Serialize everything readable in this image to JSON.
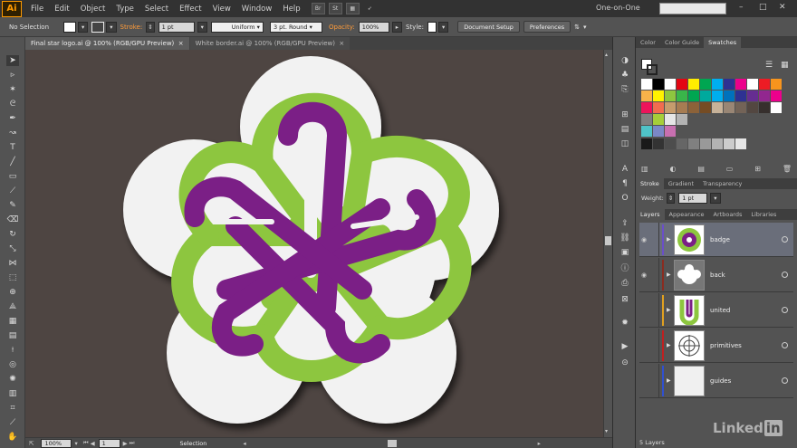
{
  "menubar": {
    "logo": "Ai",
    "items": [
      "File",
      "Edit",
      "Object",
      "Type",
      "Select",
      "Effect",
      "View",
      "Window",
      "Help"
    ],
    "app_buttons": [
      "Br",
      "St"
    ],
    "workspace": "One-on-One"
  },
  "controlbar": {
    "selection": "No Selection",
    "stroke_label": "Stroke:",
    "stroke_value": "1 pt",
    "profile": "Uniform",
    "brush": "3 pt. Round",
    "opacity_label": "Opacity:",
    "opacity_value": "100%",
    "style_label": "Style:",
    "document_setup": "Document Setup",
    "preferences": "Preferences"
  },
  "doc_tabs": [
    {
      "label": "Final star logo.ai @ 100% (RGB/GPU Preview)",
      "close": "×"
    },
    {
      "label": "White border.ai @ 100% (RGB/GPU Preview)",
      "close": "×"
    }
  ],
  "statusbar": {
    "zoom": "100%",
    "artboard": "1",
    "tool": "Selection"
  },
  "swatches_panel": {
    "tabs": [
      "Color",
      "Color Guide",
      "Swatches"
    ],
    "rows": [
      [
        "#ffffff",
        "#000000",
        "#ffffff",
        "#e30613",
        "#ffed00",
        "#00a651",
        "#00aeef",
        "#2e3192",
        "#ec008c",
        "#ffffff"
      ],
      [
        "#ed1c24",
        "#f7941d",
        "#f7b34a",
        "#fff200",
        "#8dc63f",
        "#39b54a",
        "#00a651",
        "#00a99d",
        "#00aeef",
        "#0072bc"
      ],
      [
        "#2e3192",
        "#662d91",
        "#92278f",
        "#ec008c",
        "#ed145b",
        "#f26c4f",
        "#c69c6d",
        "#a67c52",
        "#8c6239",
        "#754c24"
      ],
      [
        "#c7b299",
        "#998675",
        "#736357",
        "#534741",
        "#362f2d",
        "#ffffff",
        "#808080",
        "#a6ce39",
        "#e6e6e6",
        "#b3b3b3"
      ]
    ],
    "extra_row": [
      "#4fc3c8",
      "#7b88c7",
      "#c86fb0"
    ],
    "gray_row": [
      "#1a1a1a",
      "#333333",
      "#4d4d4d",
      "#666666",
      "#808080",
      "#999999",
      "#b3b3b3",
      "#cccccc",
      "#e6e6e6"
    ]
  },
  "stroke_panel": {
    "tabs": [
      "Stroke",
      "Gradient",
      "Transparency"
    ],
    "weight_label": "Weight:",
    "weight_value": "1 pt"
  },
  "layers_panel": {
    "tabs": [
      "Layers",
      "Appearance",
      "Artboards",
      "Libraries"
    ],
    "layers": [
      {
        "name": "badge",
        "color": "#6a4fc9",
        "selected": true
      },
      {
        "name": "back",
        "color": "#8a2c20",
        "selected": false
      },
      {
        "name": "united",
        "color": "#e0a020",
        "selected": false
      },
      {
        "name": "primitives",
        "color": "#c02020",
        "selected": false
      },
      {
        "name": "guides",
        "color": "#3050d0",
        "selected": false
      }
    ],
    "count": "5 Layers"
  },
  "watermark": {
    "text": "Linked",
    "suffix": "in"
  },
  "colors": {
    "green": "#8dc63f",
    "purple": "#7b1f86",
    "canvas": "#4e4542"
  }
}
